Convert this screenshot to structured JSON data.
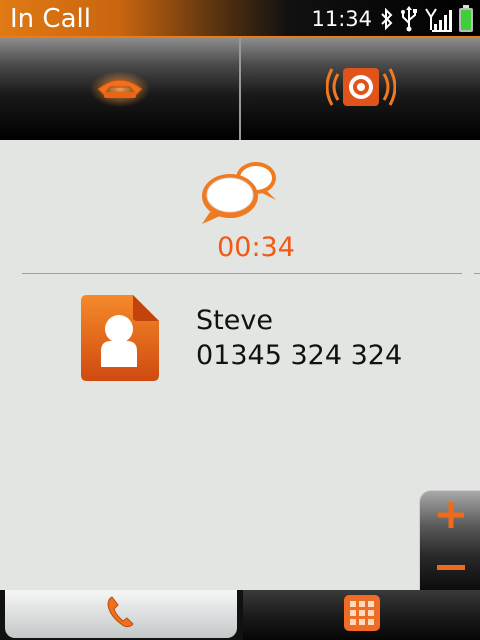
{
  "titlebar": {
    "title": "In Call"
  },
  "status": {
    "time": "11:34",
    "icons": [
      "bluetooth-icon",
      "usb-icon",
      "signal-icon",
      "battery-icon"
    ]
  },
  "actions": [
    {
      "name": "end-call",
      "icon": "hangup-icon"
    },
    {
      "name": "speaker",
      "icon": "speaker-icon"
    }
  ],
  "call": {
    "duration": "00:34",
    "icon": "chat-bubbles-icon"
  },
  "contact": {
    "name": "Steve",
    "number": "01345 324 324",
    "icon": "contact-card-icon"
  },
  "volume": {
    "up_icon": "plus-icon",
    "down_icon": "minus-icon"
  },
  "tabs": [
    {
      "name": "call",
      "icon": "phone-handset-icon",
      "selected": true
    },
    {
      "name": "keypad",
      "icon": "keypad-icon",
      "selected": false
    }
  ],
  "colors": {
    "accent": "#f05a14",
    "background": "#e2e5e2"
  }
}
